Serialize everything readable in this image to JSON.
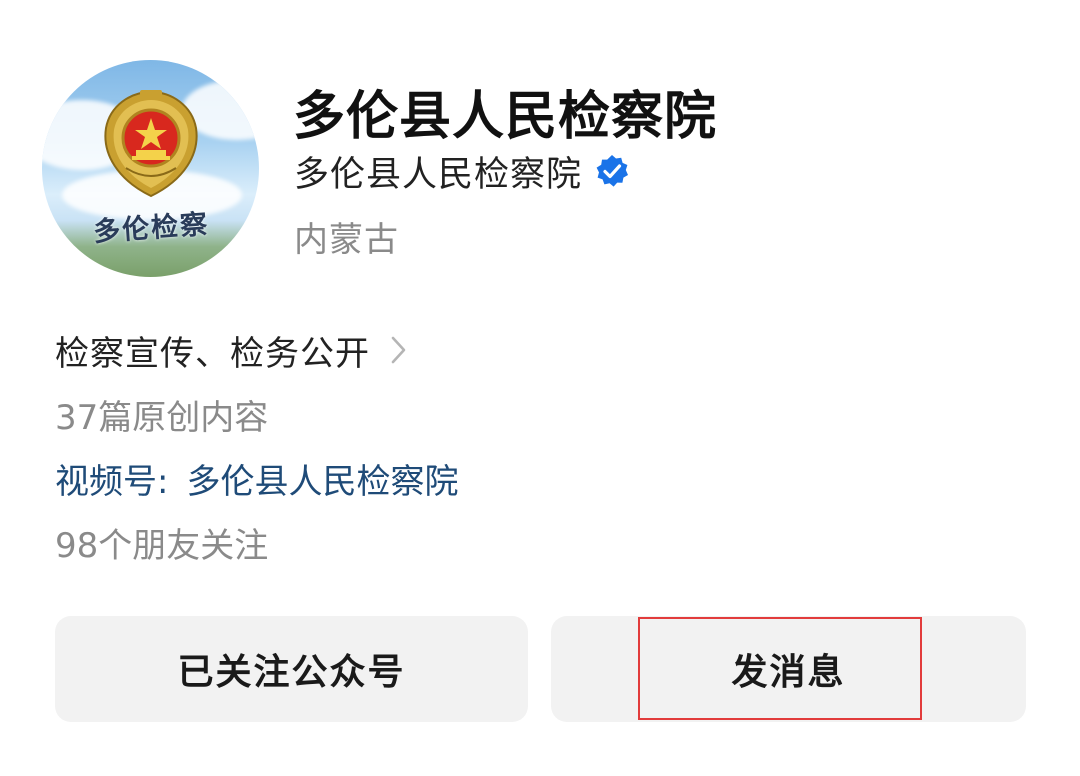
{
  "profile": {
    "display_name": "多伦县人民检察院",
    "account_name": "多伦县人民检察院",
    "verified_icon": "verified-badge-icon",
    "region": "内蒙古",
    "avatar_text": "多伦检察"
  },
  "info": {
    "intro": "检察宣传、检务公开",
    "original_count": "37篇原创内容",
    "channels_label": "视频号:",
    "channels_name": "多伦县人民检察院",
    "friends_follow": "98个朋友关注"
  },
  "actions": {
    "follow_label": "已关注公众号",
    "message_label": "发消息"
  },
  "colors": {
    "verified_blue": "#1a73e8",
    "link_blue": "#1f4b78",
    "highlight_red": "#e23c3c",
    "button_bg": "#f2f2f2"
  }
}
